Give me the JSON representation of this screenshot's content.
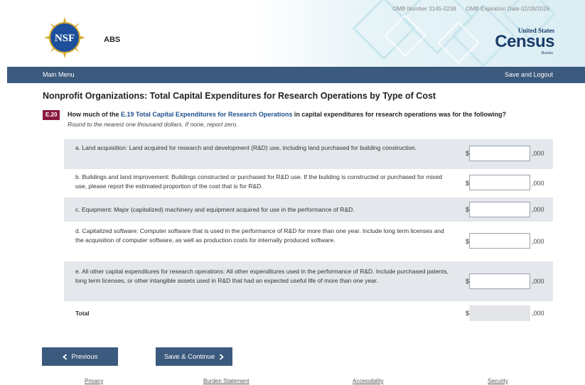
{
  "header": {
    "top_links": [
      "OMB Number 3145-0238",
      "OMB Expiration Date 02/28/2026"
    ],
    "survey_name": "ABS",
    "census_logo": {
      "line1": "United States",
      "word": "Census",
      "line3": "Bureau"
    },
    "nsf_logo_text": "NSF"
  },
  "nav": {
    "main_menu": "Main Menu",
    "save_logout": "Save and Logout"
  },
  "page": {
    "title": "Nonprofit Organizations: Total Capital Expenditures for Research Operations by Type of Cost",
    "question_number": "E.20",
    "question_prefix": "How much of the ",
    "question_link": "E.19 Total Capital Expenditures for Research Operations",
    "question_suffix": " in capital expenditures for research operations was for the following?",
    "instruction": "Round to the nearest one thousand dollars. If none, report zero."
  },
  "rows": [
    {
      "desc": "a. Land acquisition: Land acquired for research and development (R&D) use, including land purchased for building construction.",
      "dollar": "$",
      "value": "",
      "thousands": ",000"
    },
    {
      "desc": "b. Buildings and land improvement: Buildings constructed or purchased for R&D use. If the building is constructed or purchased for mixed use, please report the estimated proportion of the cost that is for R&D.",
      "dollar": "$",
      "value": "",
      "thousands": ",000"
    },
    {
      "desc": "c. Equipment: Major (capitalized) machinery and equipment acquired for use in the performance of R&D.",
      "dollar": "$",
      "value": "",
      "thousands": ",000"
    },
    {
      "desc": "d. Capitalized software: Computer software that is used in the performance of R&D for more than one year. Include long term licenses and the acquisition of computer software, as well as production costs for internally produced software.",
      "dollar": "$",
      "value": "",
      "thousands": ",000"
    },
    {
      "desc": "e. All other capital expenditures for research operations: All other expenditures used in the performance of R&D. Include purchased patents, long term licenses, or other intangible assets used in R&D that had an expected useful life of more than one year.",
      "dollar": "$",
      "value": "",
      "thousands": ",000"
    }
  ],
  "total": {
    "label": "Total",
    "dollar": "$",
    "value": "",
    "thousands": ",000"
  },
  "buttons": {
    "previous": "Previous",
    "previous_icon": "chevron-left-icon",
    "next": "Save & Continue",
    "next_icon": "chevron-right-icon"
  },
  "footer": {
    "privacy": "Privacy",
    "burden": "Burden Statement",
    "accessibility": "Accessibility",
    "security": "Security"
  },
  "colors": {
    "nav": "#3c5a7d",
    "question_badge": "#8b1a3f",
    "link": "#1f4f8b",
    "row_shade": "#e4e7eb"
  }
}
